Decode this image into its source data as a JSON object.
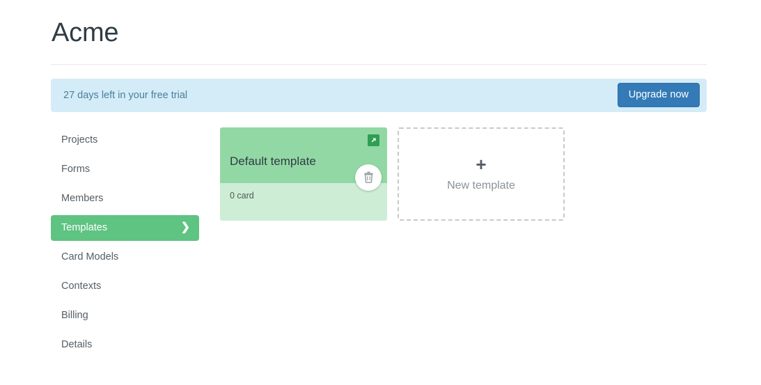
{
  "header": {
    "title": "Acme"
  },
  "trial_banner": {
    "message": "27 days left in your free trial",
    "upgrade_label": "Upgrade now",
    "background_color": "#d4ecf7",
    "text_color": "#4a7e9b",
    "button_color": "#337ab7"
  },
  "sidebar": {
    "items": [
      {
        "label": "Projects",
        "active": false
      },
      {
        "label": "Forms",
        "active": false
      },
      {
        "label": "Members",
        "active": false
      },
      {
        "label": "Templates",
        "active": true,
        "chevron": "❯"
      },
      {
        "label": "Card Models",
        "active": false
      },
      {
        "label": "Contexts",
        "active": false
      },
      {
        "label": "Billing",
        "active": false
      },
      {
        "label": "Details",
        "active": false
      }
    ],
    "active_color": "#5fc381"
  },
  "main": {
    "templates": [
      {
        "name": "Default template",
        "count_label": "0 card",
        "edit_icon": "open-external-icon",
        "delete_icon": "trash-icon",
        "header_color": "#92d8a4",
        "footer_color": "#cdedd5"
      }
    ],
    "new_template": {
      "label": "New template",
      "plus_icon": "plus-icon"
    }
  }
}
